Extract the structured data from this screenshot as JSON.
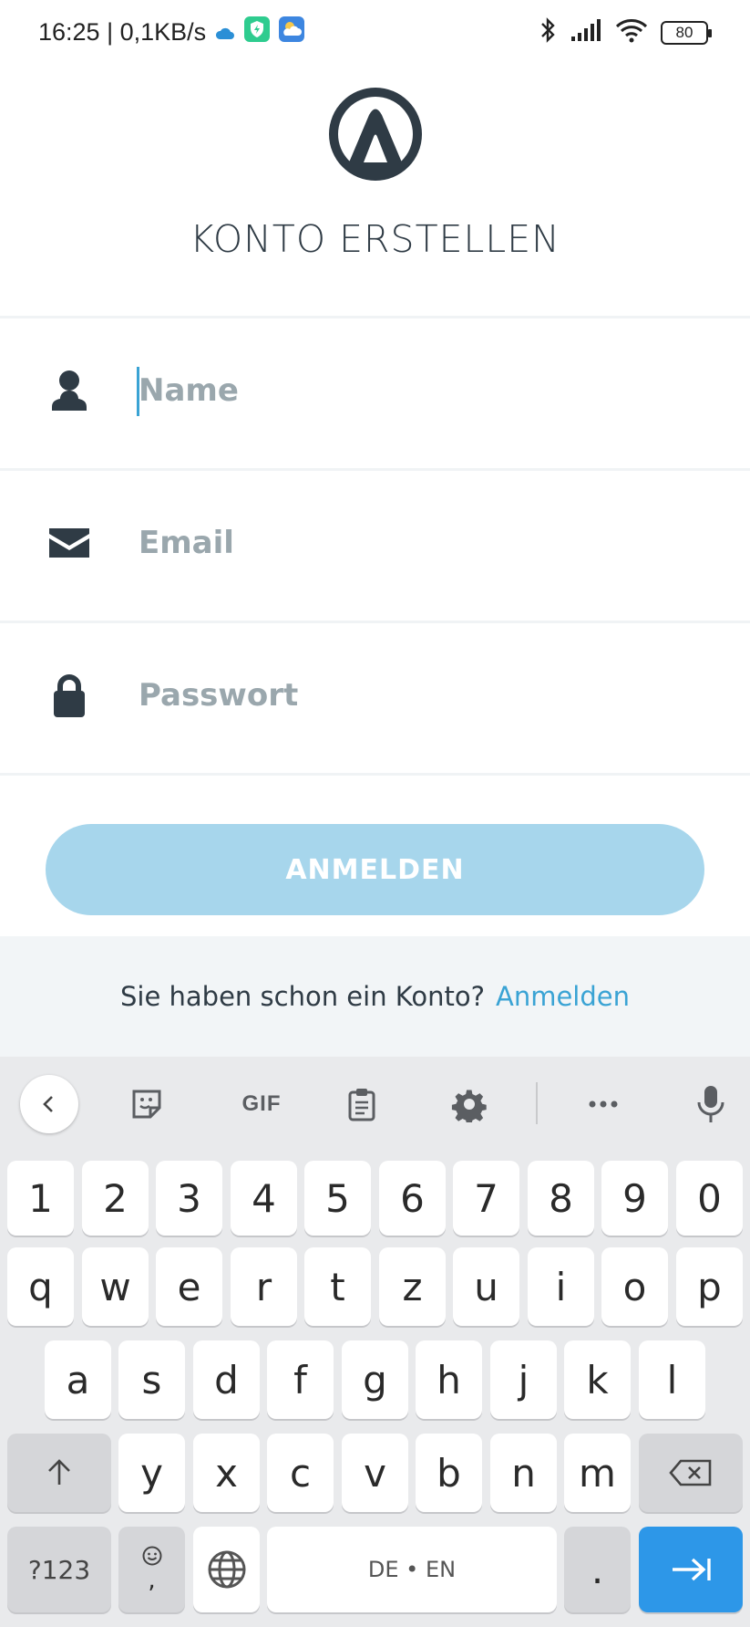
{
  "status_bar": {
    "time_speed": "16:25 | 0,1KB/s",
    "battery": "80"
  },
  "header": {
    "title": "KONTO ERSTELLEN"
  },
  "form": {
    "name_placeholder": "Name",
    "email_placeholder": "Email",
    "password_placeholder": "Passwort",
    "submit_label": "ANMELDEN"
  },
  "login_prompt": {
    "question": "Sie haben schon ein Konto?",
    "link": "Anmelden"
  },
  "keyboard": {
    "toolbar": {
      "gif_label": "GIF"
    },
    "number_row": [
      "1",
      "2",
      "3",
      "4",
      "5",
      "6",
      "7",
      "8",
      "9",
      "0"
    ],
    "row1": [
      "q",
      "w",
      "e",
      "r",
      "t",
      "z",
      "u",
      "i",
      "o",
      "p"
    ],
    "row2": [
      "a",
      "s",
      "d",
      "f",
      "g",
      "h",
      "j",
      "k",
      "l"
    ],
    "row3": [
      "y",
      "x",
      "c",
      "v",
      "b",
      "n",
      "m"
    ],
    "symbols_label": "?123",
    "comma_label": ",",
    "space_label": "DE • EN",
    "period_label": "."
  },
  "colors": {
    "primary_text": "#2f3b45",
    "accent": "#3aa3d4",
    "button_disabled": "#a7d6ec",
    "enter_key": "#2d97e8"
  }
}
